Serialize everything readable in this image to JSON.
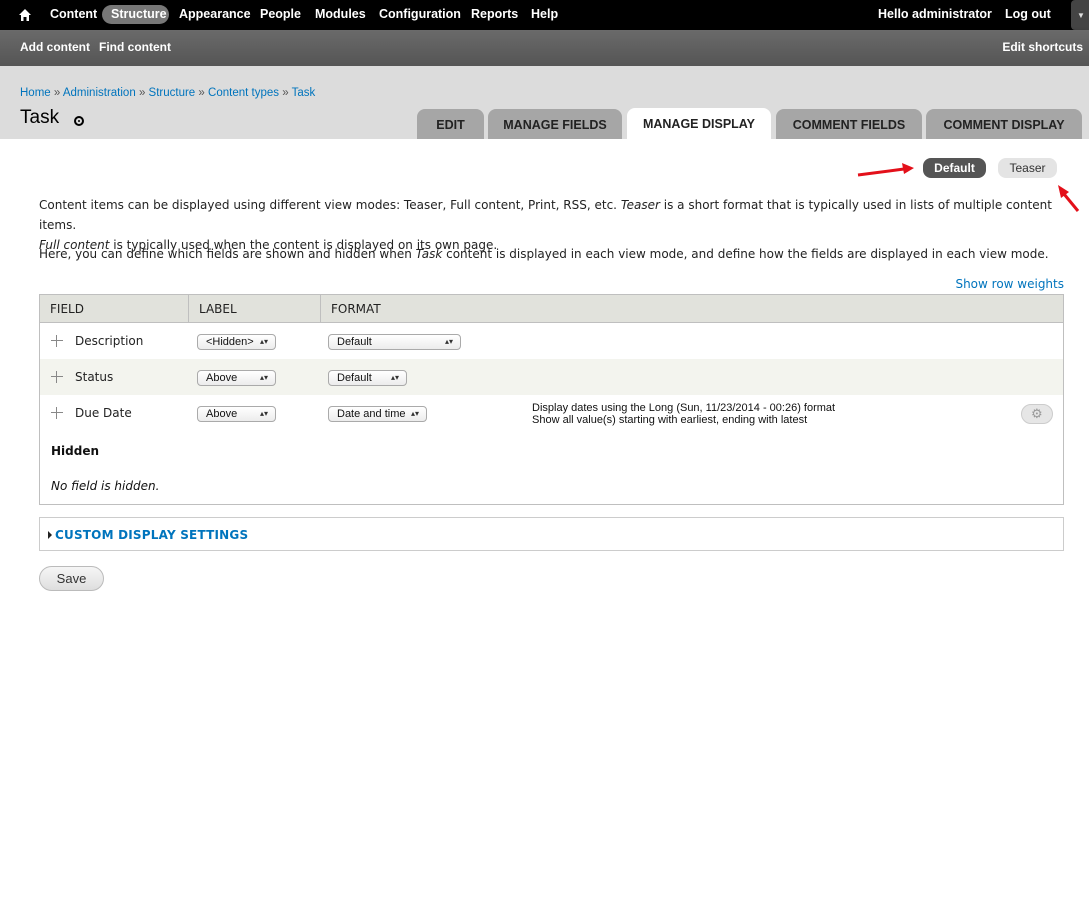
{
  "toolbar": {
    "items": [
      "Content",
      "Structure",
      "Appearance",
      "People",
      "Modules",
      "Configuration",
      "Reports",
      "Help"
    ],
    "greeting": "Hello",
    "user": "administrator",
    "logout": "Log out"
  },
  "shortcuts": {
    "add_content": "Add content",
    "find_content": "Find content",
    "edit_shortcuts": "Edit shortcuts"
  },
  "breadcrumb": {
    "items": [
      "Home",
      "Administration",
      "Structure",
      "Content types",
      "Task"
    ],
    "separator": "»"
  },
  "page_title": "Task",
  "tabs": [
    "EDIT",
    "MANAGE FIELDS",
    "MANAGE DISPLAY",
    "COMMENT FIELDS",
    "COMMENT DISPLAY"
  ],
  "active_tab": "MANAGE DISPLAY",
  "view_modes": {
    "default": "Default",
    "teaser": "Teaser",
    "active": "Default"
  },
  "description": {
    "p1_a": "Content items can be displayed using different view modes: Teaser, Full content, Print, RSS, etc. ",
    "p1_em1": "Teaser",
    "p1_b": " is a short format that is typically used in lists of multiple content items.",
    "p1_em2": "Full content",
    "p1_c": " is typically used when the content is displayed on its own page.",
    "p2_a": "Here, you can define which fields are shown and hidden when ",
    "p2_em": "Task",
    "p2_b": " content is displayed in each view mode, and define how the fields are displayed in each view mode."
  },
  "show_row_weights": "Show row weights",
  "table": {
    "headers": {
      "field": "FIELD",
      "label": "LABEL",
      "format": "FORMAT"
    },
    "rows": [
      {
        "field": "Description",
        "label": "<Hidden>",
        "format": "Default",
        "summary1": "",
        "summary2": ""
      },
      {
        "field": "Status",
        "label": "Above",
        "format": "Default",
        "summary1": "",
        "summary2": ""
      },
      {
        "field": "Due Date",
        "label": "Above",
        "format": "Date and time",
        "summary1": "Display dates using the Long (Sun, 11/23/2014 - 00:26) format",
        "summary2": "Show all value(s) starting with earliest, ending with latest"
      }
    ],
    "hidden_heading": "Hidden",
    "no_hidden": "No field is hidden."
  },
  "custom_settings": "CUSTOM DISPLAY SETTINGS",
  "save": "Save",
  "colors": {
    "link": "#0074bd",
    "toolbar": "#000000",
    "annotation_arrow": "#e3101a"
  }
}
